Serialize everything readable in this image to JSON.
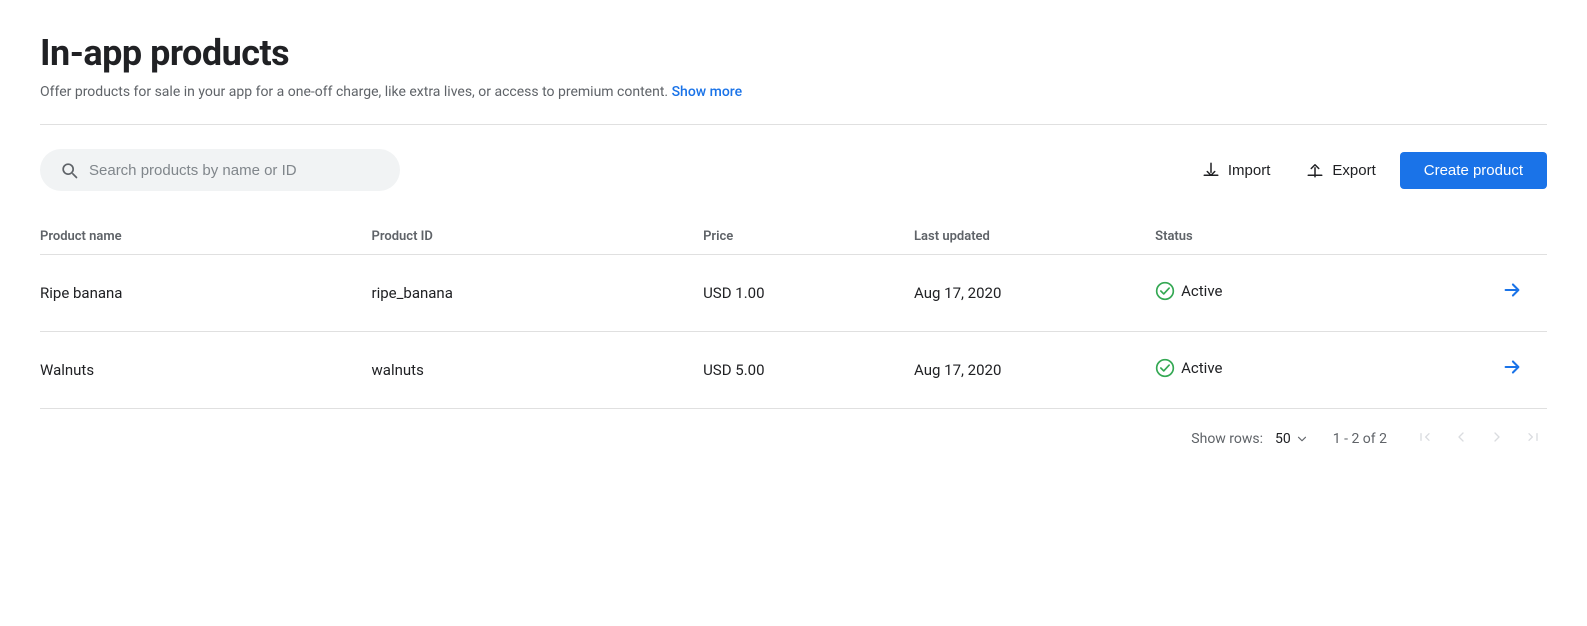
{
  "page": {
    "title": "In-app products",
    "subtitle": "Offer products for sale in your app for a one-off charge, like extra lives, or access to premium content.",
    "show_more_label": "Show more"
  },
  "toolbar": {
    "search_placeholder": "Search products by name or ID",
    "import_label": "Import",
    "export_label": "Export",
    "create_label": "Create product"
  },
  "table": {
    "columns": [
      {
        "key": "name",
        "label": "Product name"
      },
      {
        "key": "id",
        "label": "Product ID"
      },
      {
        "key": "price",
        "label": "Price"
      },
      {
        "key": "updated",
        "label": "Last updated"
      },
      {
        "key": "status",
        "label": "Status"
      }
    ],
    "rows": [
      {
        "name": "Ripe banana",
        "id": "ripe_banana",
        "price": "USD 1.00",
        "updated": "Aug 17, 2020",
        "status": "Active"
      },
      {
        "name": "Walnuts",
        "id": "walnuts",
        "price": "USD 5.00",
        "updated": "Aug 17, 2020",
        "status": "Active"
      }
    ]
  },
  "pagination": {
    "rows_label": "Show rows:",
    "rows_per_page": "50",
    "page_info": "1 - 2 of 2"
  },
  "colors": {
    "blue": "#1a73e8",
    "green": "#34a853"
  }
}
